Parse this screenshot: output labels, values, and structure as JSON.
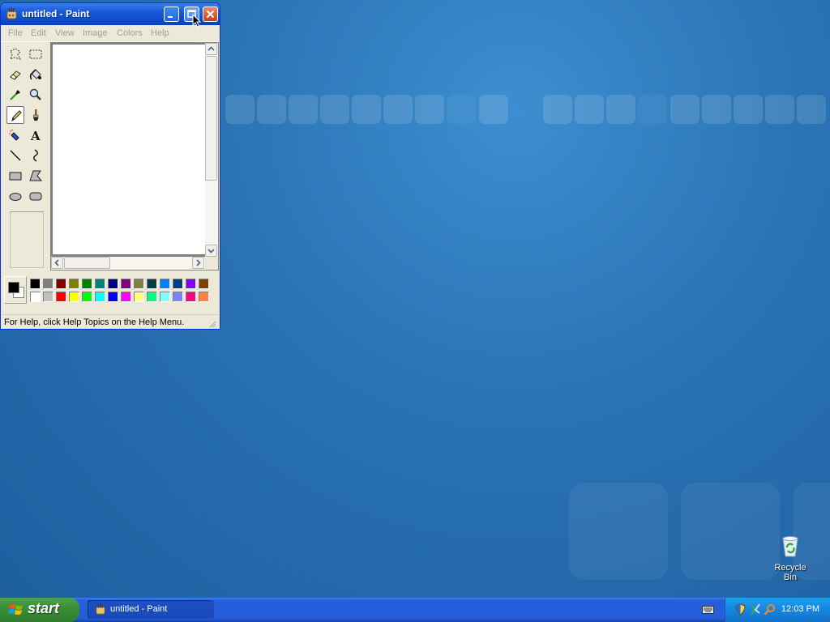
{
  "window": {
    "title": "untitled - Paint",
    "menus": [
      "File",
      "Edit",
      "View",
      "Image",
      "Colors",
      "Help"
    ],
    "status": "For Help, click Help Topics on the Help Menu.",
    "active_tool": "pencil"
  },
  "tools": [
    {
      "name": "free-form-select-icon"
    },
    {
      "name": "select-icon"
    },
    {
      "name": "eraser-icon"
    },
    {
      "name": "fill-icon"
    },
    {
      "name": "pick-color-icon"
    },
    {
      "name": "magnifier-icon"
    },
    {
      "name": "pencil-icon"
    },
    {
      "name": "brush-icon"
    },
    {
      "name": "airbrush-icon"
    },
    {
      "name": "text-icon"
    },
    {
      "name": "line-icon"
    },
    {
      "name": "curve-icon"
    },
    {
      "name": "rectangle-icon"
    },
    {
      "name": "polygon-icon"
    },
    {
      "name": "ellipse-icon"
    },
    {
      "name": "rounded-rectangle-icon"
    }
  ],
  "palette": {
    "foreground": "#000000",
    "background": "#ffffff",
    "top_row": [
      "#000000",
      "#808080",
      "#800000",
      "#808000",
      "#008000",
      "#008080",
      "#000080",
      "#800080",
      "#808040",
      "#004040",
      "#0080ff",
      "#004080",
      "#8000ff",
      "#804000"
    ],
    "bottom_row": [
      "#ffffff",
      "#c0c0c0",
      "#ff0000",
      "#ffff00",
      "#00ff00",
      "#00ffff",
      "#0000ff",
      "#ff00ff",
      "#ffff80",
      "#00ff80",
      "#80ffff",
      "#8080ff",
      "#ff0080",
      "#ff8040"
    ]
  },
  "desktop": {
    "recycle_bin_label": "Recycle Bin"
  },
  "taskbar": {
    "start_label": "start",
    "task_label": "untitled - Paint",
    "clock": "12:03 PM"
  }
}
